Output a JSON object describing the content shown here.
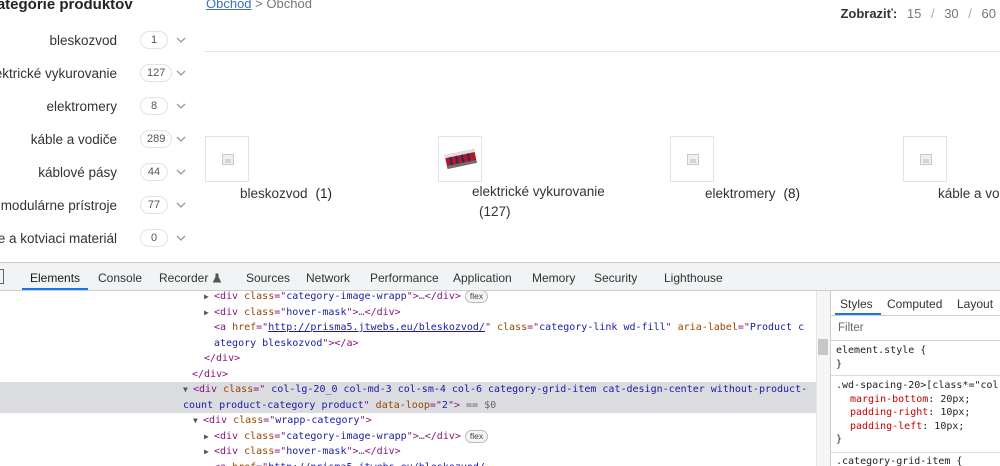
{
  "sidebar": {
    "title": "Kategórie produktov",
    "categories": [
      {
        "name": "bleskozvod",
        "count": "1"
      },
      {
        "name": "elektrické vykurovanie",
        "count": "127"
      },
      {
        "name": "elektromery",
        "count": "8"
      },
      {
        "name": "káble a vodiče",
        "count": "289"
      },
      {
        "name": "káblové pásy",
        "count": "44"
      },
      {
        "name": "modulárne prístroje",
        "count": "77"
      },
      {
        "name": "montážne lišty, svorky, podložie a kotviaci materiál",
        "count": "0"
      }
    ]
  },
  "breadcrumb": {
    "link": "Obchod",
    "separator": ">",
    "current": "Obchod"
  },
  "per_page": {
    "label": "Zobraziť:",
    "options": [
      "15",
      "30",
      "60"
    ],
    "separator": "/"
  },
  "tiles": [
    {
      "name": "bleskozvod",
      "count": "(1)"
    },
    {
      "name": "elektrické vykurovanie",
      "count": "(127)"
    },
    {
      "name": "elektromery",
      "count": "(8)"
    },
    {
      "name": "káble a vo"
    }
  ],
  "devtools": {
    "tabs": [
      "Elements",
      "Console",
      "Recorder",
      "Sources",
      "Network",
      "Performance",
      "Application",
      "Memory",
      "Security",
      "Lighthouse"
    ],
    "active_tab": "Elements",
    "dom": {
      "l1_class": "category-image-wrapp",
      "l2_class": "hover-mask",
      "l3_href": "http://prisma5.jtwebs.eu/bleskozvod/",
      "l3_class": "category-link wd-fill",
      "l3_aria_a": "Product c",
      "l3_aria_b": "ategory bleskozvod",
      "sel_class_a": " col-lg-20_0 col-md-3 col-sm-4 col-6 category-grid-item cat-design-center without-product-",
      "sel_class_b": "count product-category product",
      "sel_loop": "2",
      "sel_eq": "== $0",
      "w_class": "wrapp-category",
      "flex_badge": "flex",
      "ellipsis": "…"
    },
    "styles_tabs": [
      "Styles",
      "Computed",
      "Layout"
    ],
    "filter_placeholder": "Filter",
    "css": {
      "element_style": "element.style {",
      "close": "}",
      "rule2_selector": ".wd-spacing-20>[class*=\"col",
      "rule2_props": [
        {
          "name": "margin-bottom",
          "value": "20px;"
        },
        {
          "name": "padding-right",
          "value": "10px;"
        },
        {
          "name": "padding-left",
          "value": "10px;"
        }
      ],
      "rule3_selector": ".category-grid-item {"
    }
  }
}
